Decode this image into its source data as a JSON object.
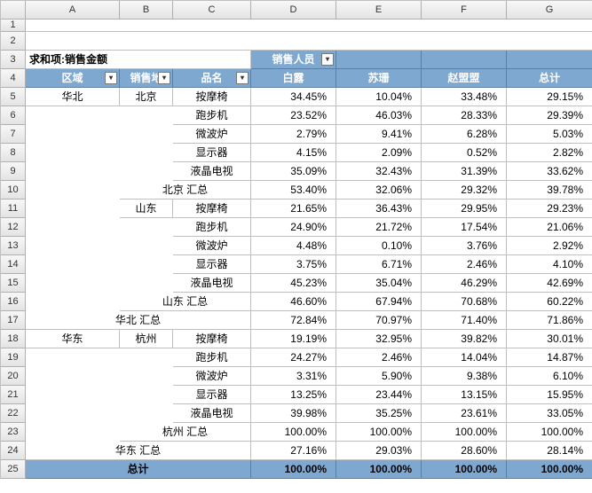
{
  "cols": [
    "A",
    "B",
    "C",
    "D",
    "E",
    "F",
    "G"
  ],
  "rowNums": [
    "1",
    "2",
    "3",
    "4",
    "5",
    "6",
    "7",
    "8",
    "9",
    "10",
    "11",
    "12",
    "13",
    "14",
    "15",
    "16",
    "17",
    "18",
    "19",
    "20",
    "21",
    "22",
    "23",
    "24",
    "25"
  ],
  "labels": {
    "measure": "求和项:销售金额",
    "salesPerson": "销售人员",
    "region": "区域",
    "city": "销售地",
    "product": "品名",
    "total": "总计",
    "regionTotal_hb": "华北 汇总",
    "regionTotal_hd": "华东 汇总",
    "cityTotal_bj": "北京 汇总",
    "cityTotal_sd": "山东 汇总",
    "cityTotal_hz": "杭州 汇总",
    "region_hb": "华北",
    "region_hd": "华东",
    "city_bj": "北京",
    "city_sd": "山东",
    "city_hz": "杭州"
  },
  "people": [
    "白露",
    "苏珊",
    "赵盟盟",
    "总计"
  ],
  "products": [
    "按摩椅",
    "跑步机",
    "微波炉",
    "显示器",
    "液晶电视"
  ],
  "rows": {
    "bj": [
      [
        "34.45%",
        "10.04%",
        "33.48%",
        "29.15%"
      ],
      [
        "23.52%",
        "46.03%",
        "28.33%",
        "29.39%"
      ],
      [
        "2.79%",
        "9.41%",
        "6.28%",
        "5.03%"
      ],
      [
        "4.15%",
        "2.09%",
        "0.52%",
        "2.82%"
      ],
      [
        "35.09%",
        "32.43%",
        "31.39%",
        "33.62%"
      ]
    ],
    "bj_total": [
      "53.40%",
      "32.06%",
      "29.32%",
      "39.78%"
    ],
    "sd": [
      [
        "21.65%",
        "36.43%",
        "29.95%",
        "29.23%"
      ],
      [
        "24.90%",
        "21.72%",
        "17.54%",
        "21.06%"
      ],
      [
        "4.48%",
        "0.10%",
        "3.76%",
        "2.92%"
      ],
      [
        "3.75%",
        "6.71%",
        "2.46%",
        "4.10%"
      ],
      [
        "45.23%",
        "35.04%",
        "46.29%",
        "42.69%"
      ]
    ],
    "sd_total": [
      "46.60%",
      "67.94%",
      "70.68%",
      "60.22%"
    ],
    "hb_total": [
      "72.84%",
      "70.97%",
      "71.40%",
      "71.86%"
    ],
    "hz": [
      [
        "19.19%",
        "32.95%",
        "39.82%",
        "30.01%"
      ],
      [
        "24.27%",
        "2.46%",
        "14.04%",
        "14.87%"
      ],
      [
        "3.31%",
        "5.90%",
        "9.38%",
        "6.10%"
      ],
      [
        "13.25%",
        "23.44%",
        "13.15%",
        "15.95%"
      ],
      [
        "39.98%",
        "35.25%",
        "23.61%",
        "33.05%"
      ]
    ],
    "hz_total": [
      "100.00%",
      "100.00%",
      "100.00%",
      "100.00%"
    ],
    "hd_total": [
      "27.16%",
      "29.03%",
      "28.60%",
      "28.14%"
    ],
    "grand": [
      "100.00%",
      "100.00%",
      "100.00%",
      "100.00%"
    ]
  },
  "icons": {
    "dropdown": "▾"
  }
}
